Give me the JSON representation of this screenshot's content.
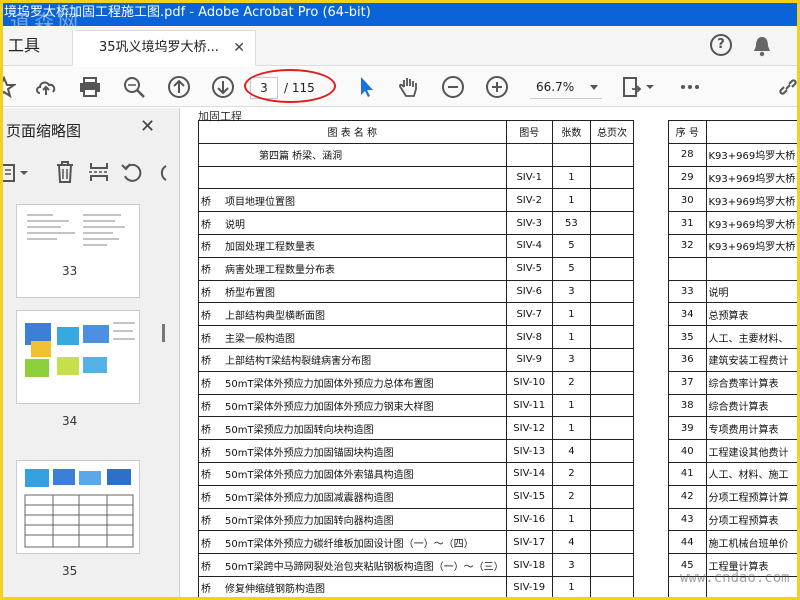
{
  "window": {
    "title": "境坞罗大桥加固工程施工图.pdf - Adobe Acrobat Pro (64-bit)"
  },
  "watermark_top": "道森网",
  "watermark_bottom": "www.cndao.com",
  "tabs": {
    "tools": "工具",
    "document": "35巩义境坞罗大桥..."
  },
  "toolbar": {
    "page_current": "3",
    "page_total": "/ 115",
    "zoom": "66.7%"
  },
  "sidebar": {
    "title": "页面缩略图",
    "thumbnails": [
      {
        "label": "33"
      },
      {
        "label": "34"
      },
      {
        "label": "35"
      }
    ]
  },
  "document": {
    "header": "加固工程",
    "left_table": {
      "headers": [
        "图 表 名 称",
        "图号",
        "张数",
        "总页次"
      ],
      "rows": [
        {
          "prefix": "",
          "name": "第四篇  桥梁、涵洞",
          "code": "",
          "count": ""
        },
        {
          "prefix": "",
          "name": "",
          "code": "SIV-1",
          "count": "1"
        },
        {
          "prefix": "桥",
          "name": "项目地理位置图",
          "code": "SIV-2",
          "count": "1"
        },
        {
          "prefix": "桥",
          "name": "说明",
          "code": "SIV-3",
          "count": "53"
        },
        {
          "prefix": "桥",
          "name": "加固处理工程数量表",
          "code": "SIV-4",
          "count": "5"
        },
        {
          "prefix": "桥",
          "name": "病害处理工程数量分布表",
          "code": "SIV-5",
          "count": "5"
        },
        {
          "prefix": "桥",
          "name": "桥型布置图",
          "code": "SIV-6",
          "count": "3"
        },
        {
          "prefix": "桥",
          "name": "上部结构典型横断面图",
          "code": "SIV-7",
          "count": "1"
        },
        {
          "prefix": "桥",
          "name": "主梁一般构造图",
          "code": "SIV-8",
          "count": "1"
        },
        {
          "prefix": "桥",
          "name": "上部结构T梁结构裂缝病害分布图",
          "code": "SIV-9",
          "count": "3"
        },
        {
          "prefix": "桥",
          "name": "50mT梁体外预应力加固体外预应力总体布置图",
          "code": "SIV-10",
          "count": "2"
        },
        {
          "prefix": "桥",
          "name": "50mT梁体外预应力加固体外预应力钢束大样图",
          "code": "SIV-11",
          "count": "1"
        },
        {
          "prefix": "桥",
          "name": "50mT梁预应力加固转向块构造图",
          "code": "SIV-12",
          "count": "1"
        },
        {
          "prefix": "桥",
          "name": "50mT梁体外预应力加固锚固块构造图",
          "code": "SIV-13",
          "count": "4"
        },
        {
          "prefix": "桥",
          "name": "50mT梁体外预应力加固体外索锚具构造图",
          "code": "SIV-14",
          "count": "2"
        },
        {
          "prefix": "桥",
          "name": "50mT梁体外预应力加固减震器构造图",
          "code": "SIV-15",
          "count": "2"
        },
        {
          "prefix": "桥",
          "name": "50mT梁体外预应力加固转向器构造图",
          "code": "SIV-16",
          "count": "1"
        },
        {
          "prefix": "桥",
          "name": "50mT梁体外预应力碳纤维板加固设计图（一）～（四）",
          "code": "SIV-17",
          "count": "4"
        },
        {
          "prefix": "桥",
          "name": "50mT梁跨中马蹄网裂处治包夹粘贴钢板构造图（一）～（三）",
          "code": "SIV-18",
          "count": "3"
        },
        {
          "prefix": "桥",
          "name": "修复伸缩缝钢筋构造图",
          "code": "SIV-19",
          "count": "1"
        }
      ]
    },
    "right_table": {
      "header": "序 号",
      "rows": [
        {
          "no": "28",
          "name": "K93+969坞罗大桥"
        },
        {
          "no": "29",
          "name": "K93+969坞罗大桥"
        },
        {
          "no": "30",
          "name": "K93+969坞罗大桥"
        },
        {
          "no": "31",
          "name": "K93+969坞罗大桥"
        },
        {
          "no": "32",
          "name": "K93+969坞罗大桥"
        },
        {
          "no": "",
          "name": ""
        },
        {
          "no": "33",
          "name": "说明"
        },
        {
          "no": "34",
          "name": "总预算表"
        },
        {
          "no": "35",
          "name": "人工、主要材料、"
        },
        {
          "no": "36",
          "name": "建筑安装工程费计"
        },
        {
          "no": "37",
          "name": "综合费率计算表"
        },
        {
          "no": "38",
          "name": "综合费计算表"
        },
        {
          "no": "39",
          "name": "专项费用计算表"
        },
        {
          "no": "40",
          "name": "工程建设其他费计"
        },
        {
          "no": "41",
          "name": "人工、材料、施工"
        },
        {
          "no": "42",
          "name": "分项工程预算计算"
        },
        {
          "no": "43",
          "name": "分项工程预算表"
        },
        {
          "no": "44",
          "name": "施工机械台班单价"
        },
        {
          "no": "45",
          "name": "工程量计算表"
        },
        {
          "no": "",
          "name": ""
        }
      ]
    }
  }
}
